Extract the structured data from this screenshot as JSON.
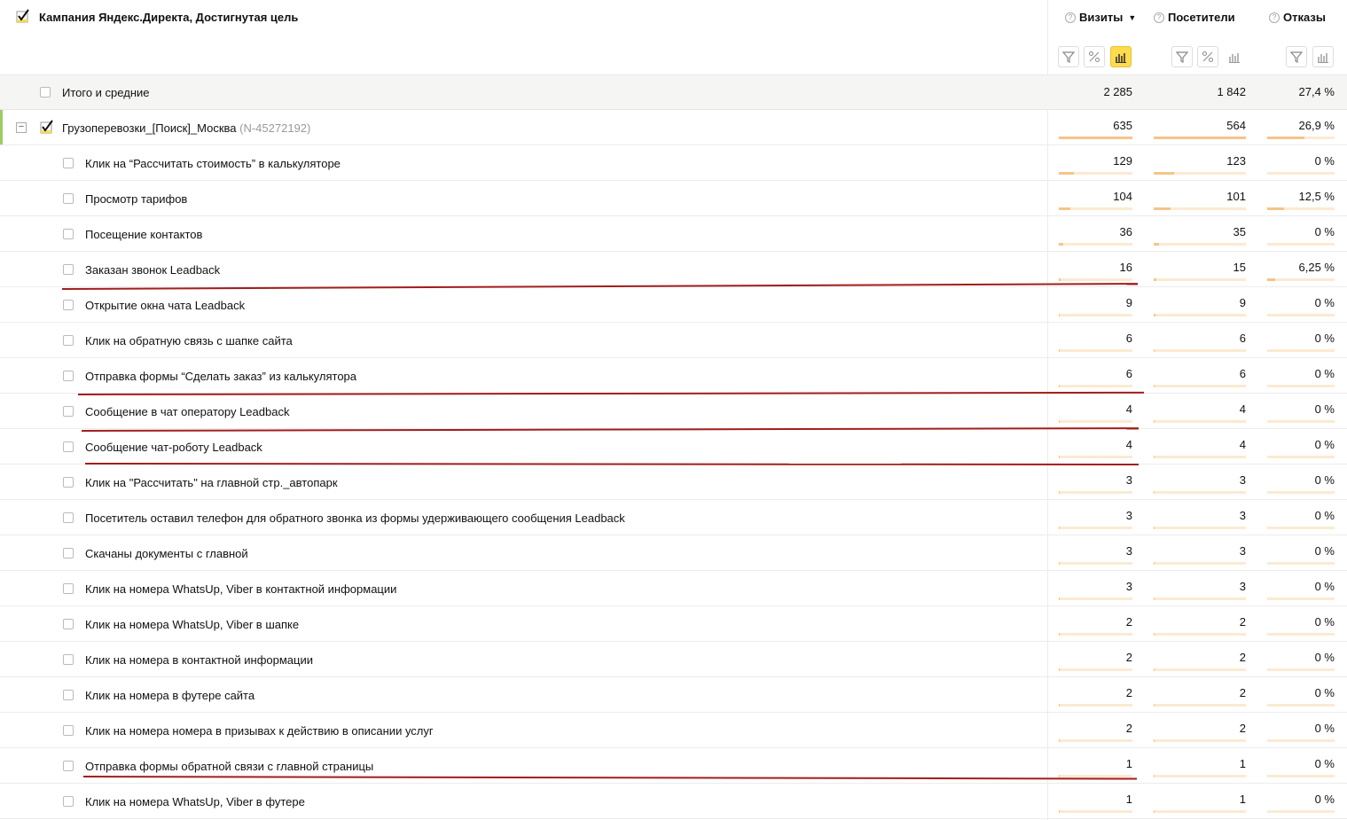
{
  "header": {
    "title": "Кампания Яндекс.Директа, Достигнутая цель",
    "columns": [
      {
        "name": "Визиты",
        "sorted": true
      },
      {
        "name": "Посетители",
        "sorted": false
      },
      {
        "name": "Отказы",
        "sorted": false
      }
    ],
    "sort_arrow": "▼",
    "help_glyph": "?"
  },
  "totals": {
    "label": "Итого и средние",
    "visits": "2 285",
    "visitors": "1 842",
    "bounce": "27,4 %"
  },
  "campaign": {
    "label": "Грузоперевозки_[Поиск]_Москва",
    "id": "(N-45272192)",
    "visits": "635",
    "visitors": "564",
    "bounce": "26,9 %",
    "collapse_glyph": "−",
    "bar_visits": 1.0,
    "bar_visitors": 1.0,
    "bar_bounce": 0.55
  },
  "rows": [
    {
      "label": "Клик на “Рассчитать стоимость” в калькуляторе",
      "visits": "129",
      "visitors": "123",
      "bounce": "0 %",
      "bv": 0.2,
      "bp": 0.22,
      "bb": 0
    },
    {
      "label": "Просмотр тарифов",
      "visits": "104",
      "visitors": "101",
      "bounce": "12,5 %",
      "bv": 0.16,
      "bp": 0.18,
      "bb": 0.25
    },
    {
      "label": "Посещение контактов",
      "visits": "36",
      "visitors": "35",
      "bounce": "0 %",
      "bv": 0.06,
      "bp": 0.06,
      "bb": 0
    },
    {
      "label": "Заказан звонок Leadback",
      "visits": "16",
      "visitors": "15",
      "bounce": "6,25 %",
      "bv": 0.03,
      "bp": 0.03,
      "bb": 0.12
    },
    {
      "label": "Открытие окна чата Leadback",
      "visits": "9",
      "visitors": "9",
      "bounce": "0 %",
      "bv": 0.015,
      "bp": 0.015,
      "bb": 0
    },
    {
      "label": "Клик на обратную связь с шапке сайта",
      "visits": "6",
      "visitors": "6",
      "bounce": "0 %",
      "bv": 0.01,
      "bp": 0.01,
      "bb": 0
    },
    {
      "label": "Отправка формы “Сделать заказ” из калькулятора",
      "visits": "6",
      "visitors": "6",
      "bounce": "0 %",
      "bv": 0.01,
      "bp": 0.01,
      "bb": 0
    },
    {
      "label": "Сообщение в чат оператору Leadback",
      "visits": "4",
      "visitors": "4",
      "bounce": "0 %",
      "bv": 0.007,
      "bp": 0.007,
      "bb": 0
    },
    {
      "label": "Сообщение чат-роботу Leadback",
      "visits": "4",
      "visitors": "4",
      "bounce": "0 %",
      "bv": 0.007,
      "bp": 0.007,
      "bb": 0
    },
    {
      "label": "Клик на \"Рассчитать\" на главной стр._автопарк",
      "visits": "3",
      "visitors": "3",
      "bounce": "0 %",
      "bv": 0.005,
      "bp": 0.005,
      "bb": 0
    },
    {
      "label": "Посетитель оставил телефон для обратного звонка из формы удерживающего сообщения Leadback",
      "visits": "3",
      "visitors": "3",
      "bounce": "0 %",
      "bv": 0.005,
      "bp": 0.005,
      "bb": 0
    },
    {
      "label": "Скачаны документы с главной",
      "visits": "3",
      "visitors": "3",
      "bounce": "0 %",
      "bv": 0.005,
      "bp": 0.005,
      "bb": 0
    },
    {
      "label": "Клик на номера WhatsUp, Viber в контактной информации",
      "visits": "3",
      "visitors": "3",
      "bounce": "0 %",
      "bv": 0.005,
      "bp": 0.005,
      "bb": 0
    },
    {
      "label": "Клик на номера WhatsUp, Viber в шапке",
      "visits": "2",
      "visitors": "2",
      "bounce": "0 %",
      "bv": 0.003,
      "bp": 0.003,
      "bb": 0
    },
    {
      "label": "Клик на номера в контактной информации",
      "visits": "2",
      "visitors": "2",
      "bounce": "0 %",
      "bv": 0.003,
      "bp": 0.003,
      "bb": 0
    },
    {
      "label": "Клик на номера в футере сайта",
      "visits": "2",
      "visitors": "2",
      "bounce": "0 %",
      "bv": 0.003,
      "bp": 0.003,
      "bb": 0
    },
    {
      "label": "Клик на номера номера в призывах к действию в описании услуг",
      "visits": "2",
      "visitors": "2",
      "bounce": "0 %",
      "bv": 0.003,
      "bp": 0.003,
      "bb": 0
    },
    {
      "label": "Отправка формы обратной связи с главной страницы",
      "visits": "1",
      "visitors": "1",
      "bounce": "0 %",
      "bv": 0.002,
      "bp": 0.002,
      "bb": 0
    },
    {
      "label": "Клик на номера WhatsUp, Viber в футере",
      "visits": "1",
      "visitors": "1",
      "bounce": "0 %",
      "bv": 0.002,
      "bp": 0.002,
      "bb": 0
    }
  ],
  "colors": {
    "accent": "#9ccc65",
    "bar": "#f5c48a",
    "bar_track": "#fbead2",
    "active_button": "#ffdb4d",
    "annotation": "#a31d1d"
  },
  "icons": {
    "filter": "filter-icon",
    "percent": "percent-icon",
    "bars": "bar-chart-icon",
    "check": "checkmark-icon"
  }
}
